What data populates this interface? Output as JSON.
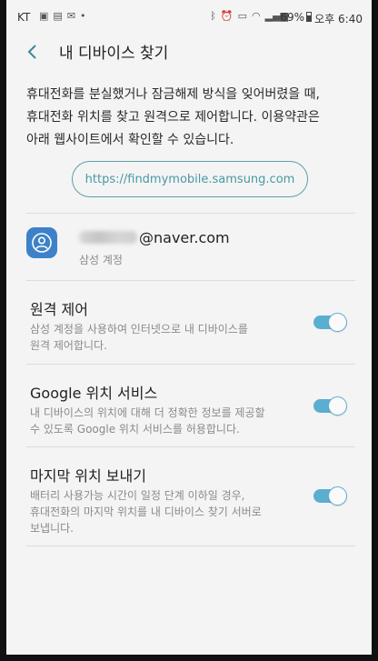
{
  "status_bar": {
    "carrier": "KT",
    "battery": "69%",
    "time": "오후 6:40"
  },
  "header": {
    "title": "내 디바이스 찾기"
  },
  "description": "휴대전화를 분실했거나 잠금해제 방식을 잊어버렸을 때,\n휴대전화 위치를 찾고 원격으로 제어합니다. 이용약관은\n아래 웹사이트에서 확인할 수 있습니다.",
  "website_button": {
    "label": "https://findmymobile.samsung.com"
  },
  "account": {
    "email_domain": "@naver.com",
    "subtitle": "삼성 계정"
  },
  "settings": [
    {
      "title": "원격 제어",
      "description": "삼성 계정을 사용하여 인터넷으로 내 디바이스를\n원격 제어합니다.",
      "enabled": true
    },
    {
      "title": "Google 위치 서비스",
      "description": "내 디바이스의 위치에 대해 더 정확한 정보를 제공할\n수 있도록 Google 위치 서비스를 허용합니다.",
      "enabled": true
    },
    {
      "title": "마지막 위치 보내기",
      "description": "배터리 사용가능 시간이 일정 단계 이하일 경우,\n휴대전화의 마지막 위치를 내 디바이스 찾기 서버로\n보냅니다.",
      "enabled": true
    }
  ],
  "colors": {
    "accent": "#5aaed0",
    "link": "#4a98a4",
    "avatar": "#3d82c8"
  }
}
